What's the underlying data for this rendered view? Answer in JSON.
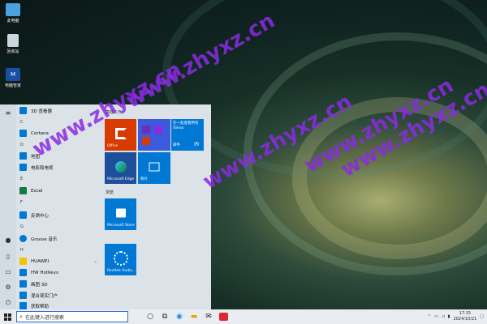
{
  "desktop": {
    "icons": [
      {
        "label": "此电脑",
        "icon": "computer-icon",
        "color": "#4aa3df"
      },
      {
        "label": "回收站",
        "icon": "recycle-bin-icon",
        "color": "#c9d6de"
      },
      {
        "label": "电脑管家",
        "icon": "pc-manager-icon",
        "color": "#1a4fa3"
      }
    ]
  },
  "watermarks": [
    "www.zhyxz.cn",
    "www.zhyxz.cn",
    "www.zhyxz.cn",
    "www.zhyxz.cn",
    "www.zhyxz.cn"
  ],
  "start_menu": {
    "letters": {
      "c": "C",
      "d": "D",
      "e": "E",
      "f": "F",
      "g": "G",
      "h": "H"
    },
    "apps": {
      "3d_viewer": "3D 查看器",
      "cortana": "Cortana",
      "maps": "地图",
      "movies": "电影和电视",
      "excel": "Excel",
      "feedback": "反馈中心",
      "groove": "Groove 音乐",
      "huawei": "HUAWEI",
      "hw_hotkeys": "HW HotKeys",
      "paint3d": "画图 3D",
      "mixed_reality": "混合现实门户",
      "camera": "获取帮助"
    },
    "groups": {
      "productivity": "高效工作",
      "browse": "浏览"
    },
    "tiles": {
      "office": "Office",
      "email_line1": "在一处查看所有 Yahoo",
      "email_line2": "邮件",
      "edge": "Microsoft Edge",
      "photos": "照片",
      "store": "Microsoft Store",
      "realtek": "Realtek Audio..."
    },
    "colors": {
      "office": "#d83b01",
      "email": "#0078d4",
      "edge": "#1f4e9a",
      "photos": "#0078d4",
      "store": "#0078d4",
      "realtek": "#0078d4",
      "chat": "#3b5bdb"
    }
  },
  "taskbar": {
    "search_placeholder": "在此键入进行搜索",
    "time": "17:15",
    "date": "2024/10/21"
  }
}
